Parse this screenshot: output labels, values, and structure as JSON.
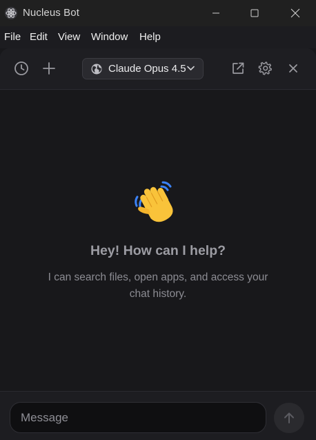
{
  "window": {
    "title": "Nucleus Bot"
  },
  "menu": [
    "File",
    "Edit",
    "View",
    "Window",
    "Help"
  ],
  "toolbar": {
    "model_name": "Claude Opus 4.5"
  },
  "empty_state": {
    "emoji": "👋",
    "title": "Hey! How can I help?",
    "subtitle": "I can search files, open apps, and access your chat history."
  },
  "composer": {
    "placeholder": "Message",
    "value": ""
  },
  "icons": {
    "app": "atom-icon",
    "history": "history-clock-icon",
    "new_chat": "plus-icon",
    "model": "globe-icon",
    "dropdown": "chevron-down-icon",
    "popout": "external-link-icon",
    "settings": "gear-icon",
    "close": "close-icon",
    "send": "arrow-up-icon"
  },
  "colors": {
    "background": "#18181b",
    "toolbar": "#1e1e22",
    "titlebar": "#202020",
    "text_muted": "#8c8c93",
    "wave_yellow": "#f9c33a",
    "wave_blue": "#3b82f6"
  }
}
